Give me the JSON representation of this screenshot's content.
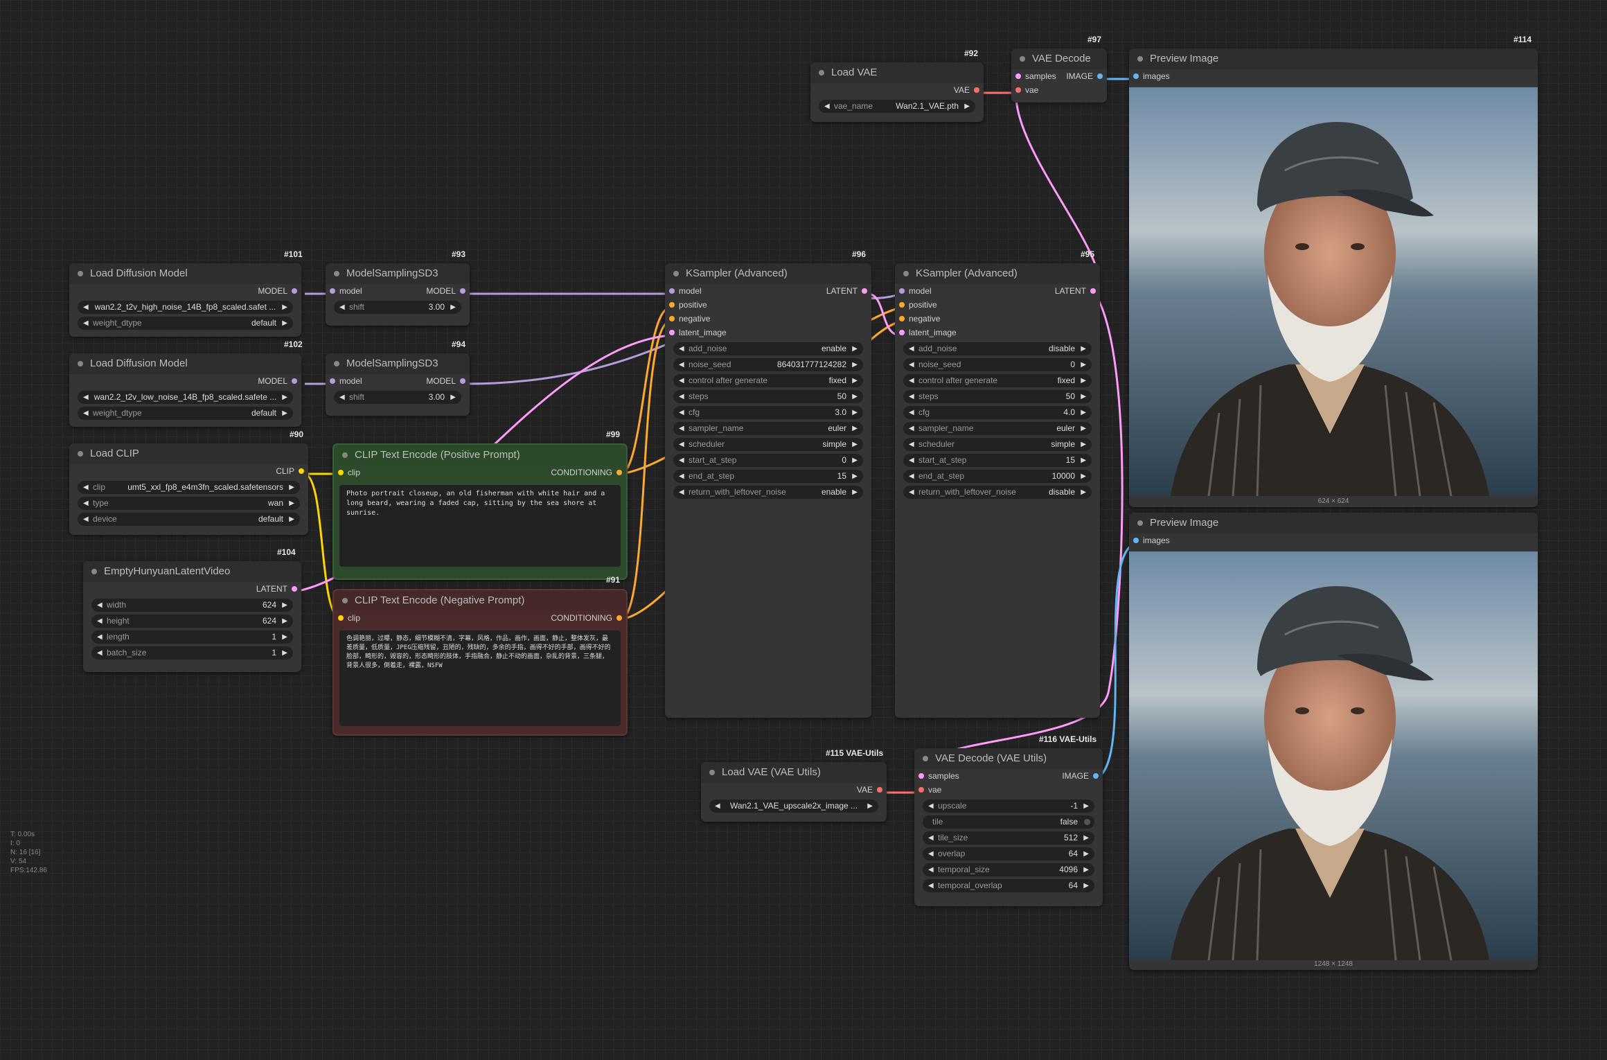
{
  "colors": {
    "model": "#b39ddb",
    "clip": "#ffd500",
    "conditioning": "#ffa931",
    "latent": "#ff9cf9",
    "vae": "#ff6e6e",
    "image": "#64b5f6"
  },
  "nodes": {
    "load_diffusion_high": {
      "id": "#101",
      "title": "Load Diffusion Model",
      "out": "MODEL",
      "unet_name": "wan2.2_t2v_high_noise_14B_fp8_scaled.safet ...",
      "weight_dtype_label": "weight_dtype",
      "weight_dtype": "default"
    },
    "model_sampling_1": {
      "id": "#93",
      "title": "ModelSamplingSD3",
      "in": "model",
      "out": "MODEL",
      "shift_label": "shift",
      "shift": "3.00"
    },
    "load_diffusion_low": {
      "id": "#102",
      "title": "Load Diffusion Model",
      "out": "MODEL",
      "unet_name": "wan2.2_t2v_low_noise_14B_fp8_scaled.safete ...",
      "weight_dtype_label": "weight_dtype",
      "weight_dtype": "default"
    },
    "model_sampling_2": {
      "id": "#94",
      "title": "ModelSamplingSD3",
      "in": "model",
      "out": "MODEL",
      "shift_label": "shift",
      "shift": "3.00"
    },
    "load_clip": {
      "id": "#90",
      "title": "Load CLIP",
      "out": "CLIP",
      "clip_label": "clip",
      "clip_name": "umt5_xxl_fp8_e4m3fn_scaled.safetensors",
      "type_label": "type",
      "type": "wan",
      "device_label": "device",
      "device": "default"
    },
    "clip_pos": {
      "id": "#99",
      "title": "CLIP Text Encode (Positive Prompt)",
      "in": "clip",
      "out": "CONDITIONING",
      "text": "Photo portrait closeup, an old fisherman with white hair and a long beard, wearing a faded cap, sitting by the sea shore at sunrise."
    },
    "clip_neg": {
      "id": "#91",
      "title": "CLIP Text Encode (Negative Prompt)",
      "in": "clip",
      "out": "CONDITIONING",
      "text": "色调艳丽，过曝，静态，细节模糊不清，字幕，风格，作品，画作，画面，静止，整体发灰，最差质量，低质量，JPEG压缩残留，丑陋的，残缺的，多余的手指，画得不好的手部，画得不好的脸部，畸形的，毁容的，形态畸形的肢体，手指融合，静止不动的画面，杂乱的背景，三条腿，背景人很多，倒着走，裸露，NSFW"
    },
    "empty_latent": {
      "id": "#104",
      "title": "EmptyHunyuanLatentVideo",
      "out": "LATENT",
      "width_label": "width",
      "width": "624",
      "height_label": "height",
      "height": "624",
      "length_label": "length",
      "length": "1",
      "batch_label": "batch_size",
      "batch": "1"
    },
    "ksampler1": {
      "id": "#96",
      "title": "KSampler (Advanced)",
      "out": "LATENT",
      "inputs": [
        "model",
        "positive",
        "negative",
        "latent_image"
      ],
      "widgets": [
        {
          "label": "add_noise",
          "value": "enable"
        },
        {
          "label": "noise_seed",
          "value": "864031777124282"
        },
        {
          "label": "control after generate",
          "value": "fixed"
        },
        {
          "label": "steps",
          "value": "50"
        },
        {
          "label": "cfg",
          "value": "3.0"
        },
        {
          "label": "sampler_name",
          "value": "euler"
        },
        {
          "label": "scheduler",
          "value": "simple"
        },
        {
          "label": "start_at_step",
          "value": "0"
        },
        {
          "label": "end_at_step",
          "value": "15"
        },
        {
          "label": "return_with_leftover_noise",
          "value": "enable"
        }
      ]
    },
    "ksampler2": {
      "id": "#95",
      "title": "KSampler (Advanced)",
      "out": "LATENT",
      "inputs": [
        "model",
        "positive",
        "negative",
        "latent_image"
      ],
      "widgets": [
        {
          "label": "add_noise",
          "value": "disable"
        },
        {
          "label": "noise_seed",
          "value": "0"
        },
        {
          "label": "control after generate",
          "value": "fixed"
        },
        {
          "label": "steps",
          "value": "50"
        },
        {
          "label": "cfg",
          "value": "4.0"
        },
        {
          "label": "sampler_name",
          "value": "euler"
        },
        {
          "label": "scheduler",
          "value": "simple"
        },
        {
          "label": "start_at_step",
          "value": "15"
        },
        {
          "label": "end_at_step",
          "value": "10000"
        },
        {
          "label": "return_with_leftover_noise",
          "value": "disable"
        }
      ]
    },
    "load_vae": {
      "id": "#92",
      "title": "Load VAE",
      "out": "VAE",
      "vae_label": "vae_name",
      "vae_name": "Wan2.1_VAE.pth"
    },
    "vae_decode": {
      "id": "#97",
      "title": "VAE Decode",
      "in1": "samples",
      "in2": "vae",
      "out": "IMAGE"
    },
    "preview1": {
      "id": "#114",
      "title": "Preview Image",
      "in": "images",
      "dims": "624 × 624"
    },
    "preview2": {
      "title": "Preview Image",
      "in": "images",
      "dims": "1248 × 1248"
    },
    "load_vae_utils": {
      "id": "#115 VAE-Utils",
      "title": "Load VAE (VAE Utils)",
      "out": "VAE",
      "vae_name": "Wan2.1_VAE_upscale2x_image ..."
    },
    "vae_decode_utils": {
      "id": "#116 VAE-Utils",
      "title": "VAE Decode (VAE Utils)",
      "in1": "samples",
      "in2": "vae",
      "out": "IMAGE",
      "widgets": [
        {
          "label": "upscale",
          "value": "-1"
        },
        {
          "label": "tile",
          "value": "false"
        },
        {
          "label": "tile_size",
          "value": "512"
        },
        {
          "label": "overlap",
          "value": "64"
        },
        {
          "label": "temporal_size",
          "value": "4096"
        },
        {
          "label": "temporal_overlap",
          "value": "64"
        }
      ]
    }
  },
  "stats": [
    "T: 0.00s",
    "I: 0",
    "N: 16 [16]",
    "V: 54",
    "FPS:142.86"
  ]
}
